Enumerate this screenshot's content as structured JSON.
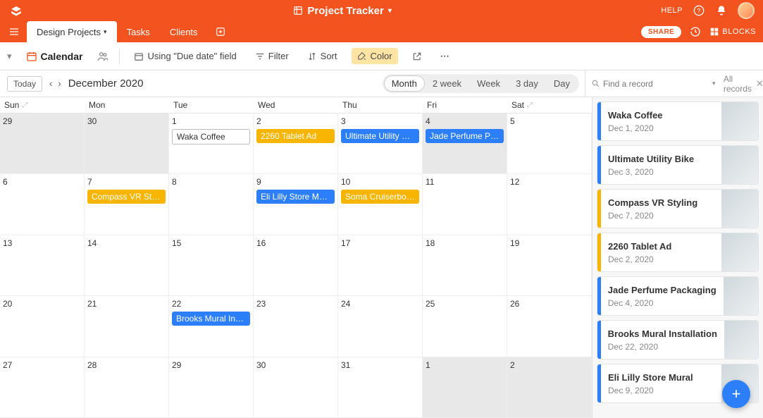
{
  "app": {
    "title": "Project Tracker"
  },
  "topbar": {
    "help": "HELP"
  },
  "tabs": {
    "items": [
      {
        "label": "Design Projects",
        "active": true
      },
      {
        "label": "Tasks",
        "active": false
      },
      {
        "label": "Clients",
        "active": false
      }
    ],
    "share": "SHARE",
    "blocks": "BLOCKS"
  },
  "toolbar": {
    "view_name": "Calendar",
    "using_field": "Using \"Due date\" field",
    "filter": "Filter",
    "sort": "Sort",
    "color": "Color"
  },
  "subbar": {
    "today": "Today",
    "period": "December 2020",
    "ranges": [
      "Month",
      "2 week",
      "Week",
      "3 day",
      "Day"
    ],
    "active_range": "Month",
    "search_placeholder": "Find a record",
    "all_records": "All records"
  },
  "calendar": {
    "dayheads": [
      "Sun",
      "Mon",
      "Tue",
      "Wed",
      "Thu",
      "Fri",
      "Sat"
    ],
    "weeks": [
      [
        {
          "num": "29",
          "muted": true,
          "events": []
        },
        {
          "num": "30",
          "muted": true,
          "events": []
        },
        {
          "num": "1",
          "events": [
            {
              "label": "Waka Coffee",
              "color": "blue",
              "outline": true
            }
          ]
        },
        {
          "num": "2",
          "events": [
            {
              "label": "2260 Tablet Ad",
              "color": "orange"
            }
          ]
        },
        {
          "num": "3",
          "events": [
            {
              "label": "Ultimate Utility Bike",
              "color": "blue"
            }
          ]
        },
        {
          "num": "4",
          "selected": true,
          "events": [
            {
              "label": "Jade Perfume Pac...",
              "color": "blue"
            }
          ]
        },
        {
          "num": "5",
          "events": []
        }
      ],
      [
        {
          "num": "6",
          "events": []
        },
        {
          "num": "7",
          "events": [
            {
              "label": "Compass VR Styli...",
              "color": "orange"
            }
          ]
        },
        {
          "num": "8",
          "events": []
        },
        {
          "num": "9",
          "events": [
            {
              "label": "Eli Lilly Store Mural",
              "color": "blue"
            }
          ]
        },
        {
          "num": "10",
          "events": [
            {
              "label": "Soma Cruiserboard",
              "color": "orange"
            }
          ]
        },
        {
          "num": "11",
          "events": []
        },
        {
          "num": "12",
          "events": []
        }
      ],
      [
        {
          "num": "13",
          "events": []
        },
        {
          "num": "14",
          "events": []
        },
        {
          "num": "15",
          "events": []
        },
        {
          "num": "16",
          "events": []
        },
        {
          "num": "17",
          "events": []
        },
        {
          "num": "18",
          "events": []
        },
        {
          "num": "19",
          "events": []
        }
      ],
      [
        {
          "num": "20",
          "events": []
        },
        {
          "num": "21",
          "events": []
        },
        {
          "num": "22",
          "events": [
            {
              "label": "Brooks Mural Inst...",
              "color": "blue"
            }
          ]
        },
        {
          "num": "23",
          "events": []
        },
        {
          "num": "24",
          "events": []
        },
        {
          "num": "25",
          "events": []
        },
        {
          "num": "26",
          "events": []
        }
      ],
      [
        {
          "num": "27",
          "events": []
        },
        {
          "num": "28",
          "events": []
        },
        {
          "num": "29",
          "events": []
        },
        {
          "num": "30",
          "events": []
        },
        {
          "num": "31",
          "events": []
        },
        {
          "num": "1",
          "muted": true,
          "events": []
        },
        {
          "num": "2",
          "muted": true,
          "events": []
        }
      ]
    ]
  },
  "sidebar": {
    "records": [
      {
        "title": "Waka Coffee",
        "date": "Dec 1, 2020",
        "color": "blue"
      },
      {
        "title": "Ultimate Utility Bike",
        "date": "Dec 3, 2020",
        "color": "blue"
      },
      {
        "title": "Compass VR Styling",
        "date": "Dec 7, 2020",
        "color": "orange"
      },
      {
        "title": "2260 Tablet Ad",
        "date": "Dec 2, 2020",
        "color": "orange"
      },
      {
        "title": "Jade Perfume Packaging",
        "date": "Dec 4, 2020",
        "color": "blue"
      },
      {
        "title": "Brooks Mural Installation",
        "date": "Dec 22, 2020",
        "color": "blue"
      },
      {
        "title": "Eli Lilly Store Mural",
        "date": "Dec 9, 2020",
        "color": "blue"
      }
    ]
  }
}
